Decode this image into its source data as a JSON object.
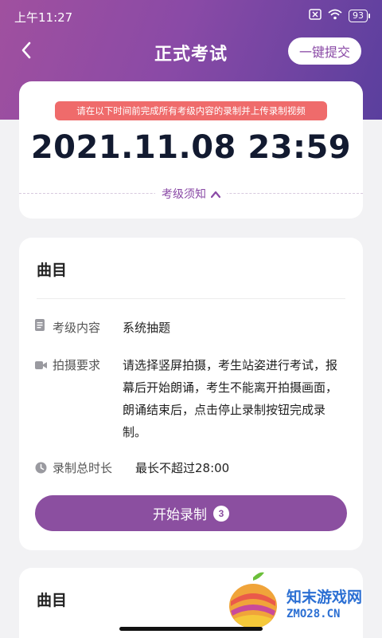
{
  "status_bar": {
    "time": "上午11:27",
    "battery": "93"
  },
  "header": {
    "title": "正式考试",
    "submit_label": "一键提交"
  },
  "deadline_card": {
    "notice": "请在以下时间前完成所有考级内容的录制并上传录制视频",
    "deadline": "2021.11.08 23:59",
    "rules_label": "考级须知"
  },
  "task": {
    "title": "曲目",
    "content_label": "考级内容",
    "content_value": "系统抽题",
    "shoot_label": "拍摄要求",
    "shoot_value": "请选择竖屏拍摄，考生站姿进行考试，报幕后开始朗诵，考生不能离开拍摄画面，朗诵结束后，点击停止录制按钮完成录制。",
    "duration_label": "录制总时长",
    "duration_value": "最长不超过28:00",
    "start_label": "开始录制",
    "start_badge": "3"
  },
  "task2": {
    "title": "曲目"
  },
  "watermark": {
    "cn": "知末游戏网",
    "en": "ZMO28.CN"
  },
  "colors": {
    "accent": "#8b4fa0",
    "notice": "#ef6b6b",
    "header_start": "#a0509f",
    "header_end": "#5a3f9e"
  }
}
